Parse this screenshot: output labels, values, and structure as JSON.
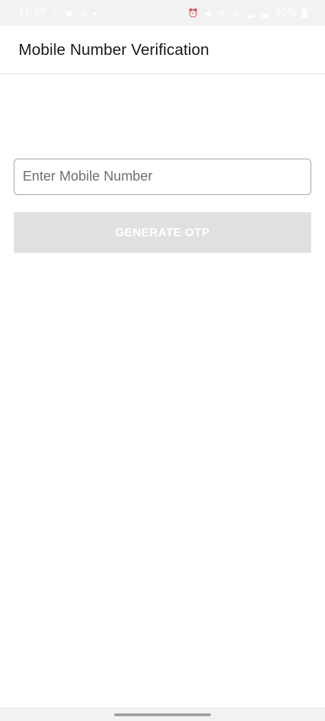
{
  "status_bar": {
    "time": "17:37",
    "battery": "92%",
    "left_icons": [
      "face-id-icon",
      "image-icon",
      "voicemail-icon",
      "dot-icon"
    ],
    "right_icons": [
      "alarm-icon",
      "mute-icon",
      "wifi-icon",
      "data-icon",
      "signal-icon",
      "signal-2-icon",
      "battery-icon"
    ]
  },
  "app_bar": {
    "title": "Mobile Number Verification"
  },
  "form": {
    "mobile_placeholder": "Enter Mobile Number",
    "mobile_value": "",
    "generate_otp_label": "GENERATE OTP"
  },
  "colors": {
    "status_bar_bg": "#f2f2f2",
    "app_bar_bg": "#ffffff",
    "button_disabled_bg": "#e0e0e0",
    "button_text": "#ffffff",
    "input_border": "#9e9e9e"
  }
}
